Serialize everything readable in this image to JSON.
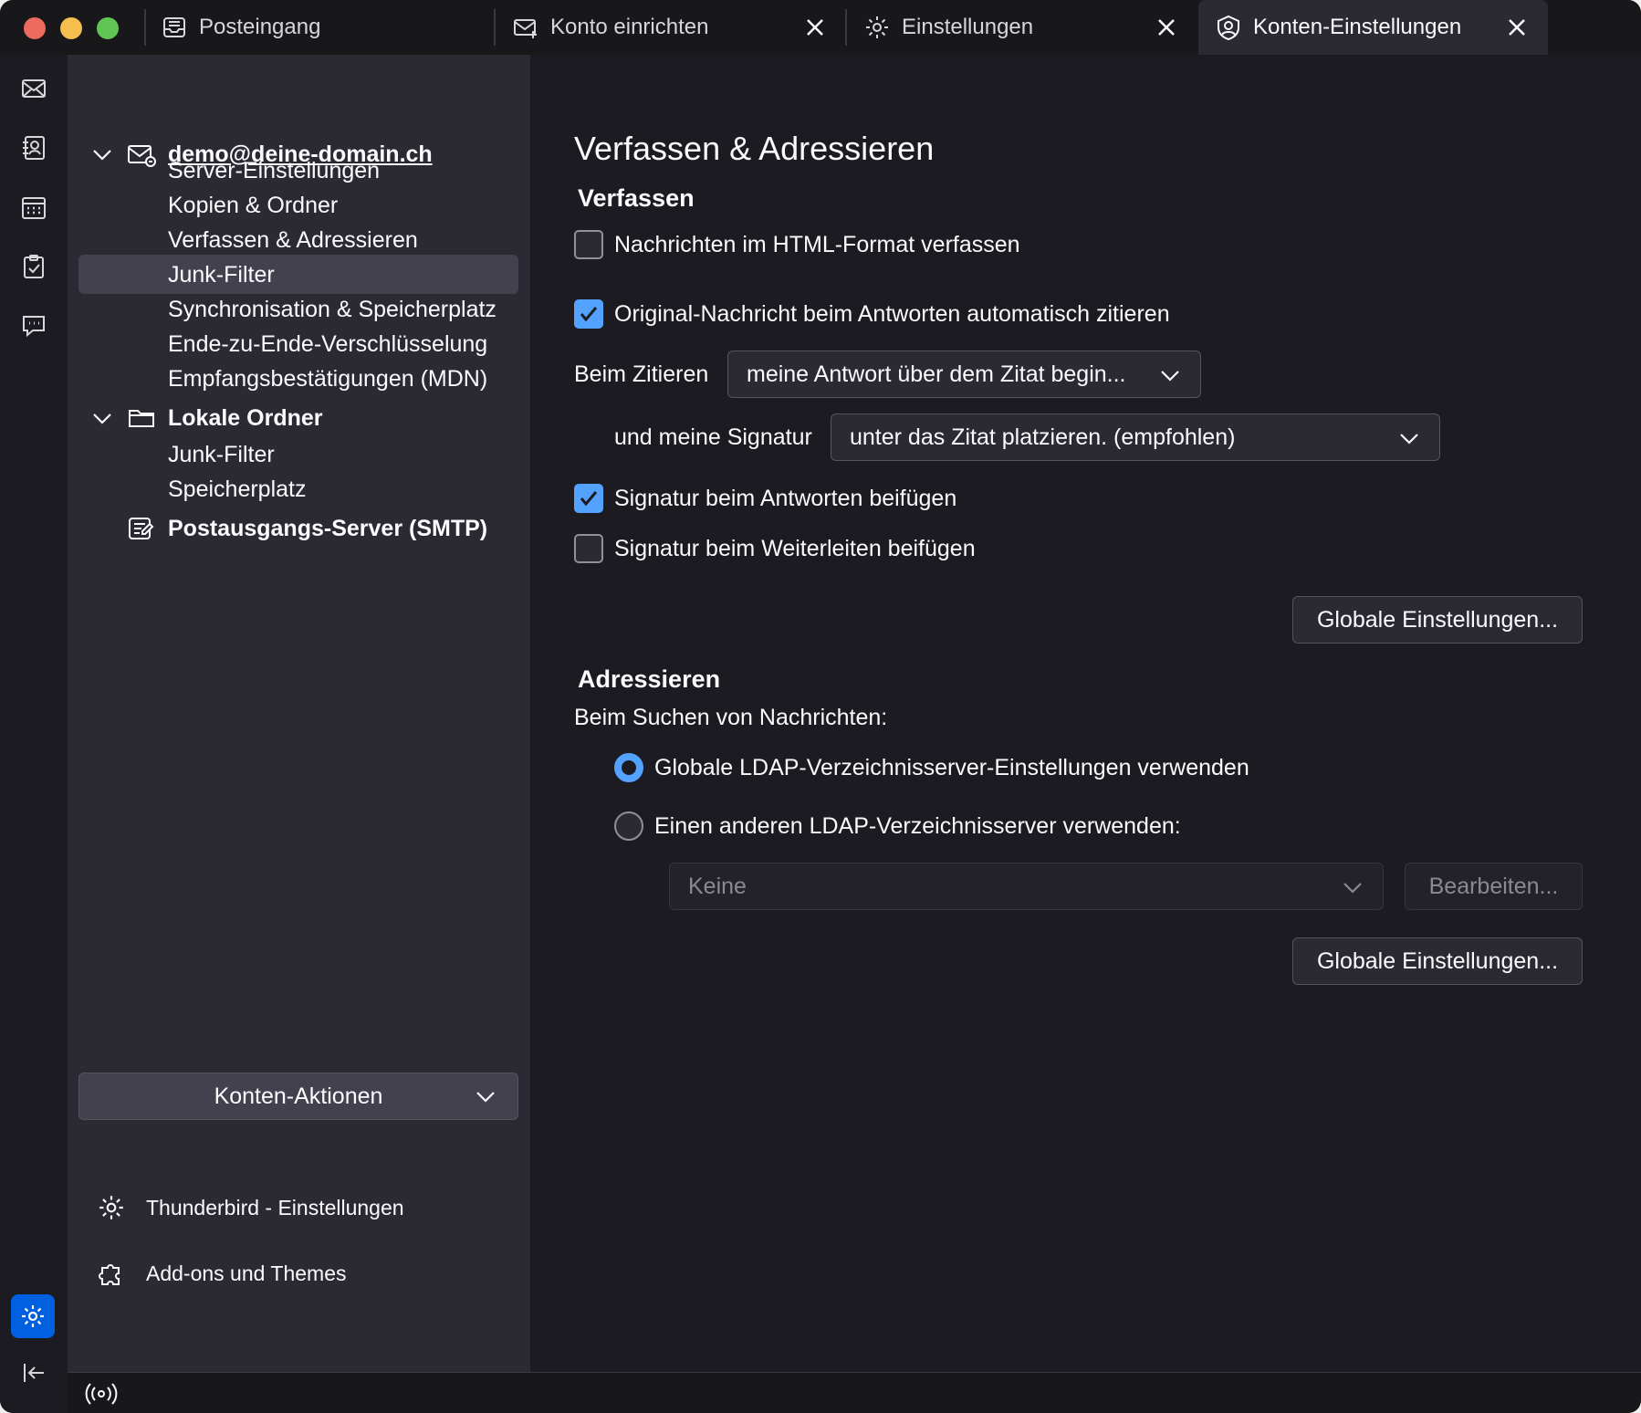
{
  "tabs": [
    {
      "label": "Posteingang",
      "icon": "inbox-icon"
    },
    {
      "label": "Konto einrichten",
      "icon": "mail-setup-icon"
    },
    {
      "label": "Einstellungen",
      "icon": "gear-icon"
    },
    {
      "label": "Konten-Einstellungen",
      "icon": "account-icon"
    }
  ],
  "spaces": [
    "mail-icon",
    "address-book-icon",
    "calendar-icon",
    "tasks-icon",
    "chat-icon",
    "settings-icon",
    "collapse-icon"
  ],
  "tree": {
    "account": "demo@deine-domain.ch",
    "account_items": [
      "Server-Einstellungen",
      "Kopien & Ordner",
      "Verfassen & Adressieren",
      "Junk-Filter",
      "Synchronisation & Speicherplatz",
      "Ende-zu-Ende-Verschlüsselung",
      "Empfangsbestätigungen (MDN)"
    ],
    "local_folders": "Lokale Ordner",
    "local_items": [
      "Junk-Filter",
      "Speicherplatz"
    ],
    "smtp": "Postausgangs-Server (SMTP)",
    "actions": "Konten-Aktionen",
    "footer": {
      "settings": "Thunderbird - Einstellungen",
      "addons": "Add-ons und Themes"
    }
  },
  "content": {
    "title": "Verfassen & Adressieren",
    "compose": {
      "heading": "Verfassen",
      "html_format": {
        "label": "Nachrichten im HTML-Format verfassen",
        "checked": false
      },
      "auto_quote": {
        "label": "Original-Nachricht beim Antworten automatisch zitieren",
        "checked": true
      },
      "quote_label": "Beim Zitieren",
      "quote_value": "meine Antwort über dem Zitat begin...",
      "signature_label": "und meine Signatur",
      "signature_value": "unter das Zitat platzieren. (empfohlen)",
      "sig_reply": {
        "label": "Signatur beim Antworten beifügen",
        "checked": true
      },
      "sig_forward": {
        "label": "Signatur beim Weiterleiten beifügen",
        "checked": false
      },
      "global_button": "Globale Einstellungen..."
    },
    "addressing": {
      "heading": "Adressieren",
      "search_label": "Beim Suchen von Nachrichten:",
      "use_global": {
        "label": "Globale LDAP-Verzeichnisserver-Einstellungen verwenden",
        "selected": true
      },
      "use_other": {
        "label": "Einen anderen LDAP-Verzeichnisserver verwenden:",
        "selected": false
      },
      "server_select": "Keine",
      "edit_button": "Bearbeiten...",
      "global_button": "Globale Einstellungen..."
    }
  },
  "colors": {
    "accent": "#54a2ff",
    "background": "#1c1b22",
    "sidebar": "#2b2a33",
    "selection": "#42414d"
  }
}
